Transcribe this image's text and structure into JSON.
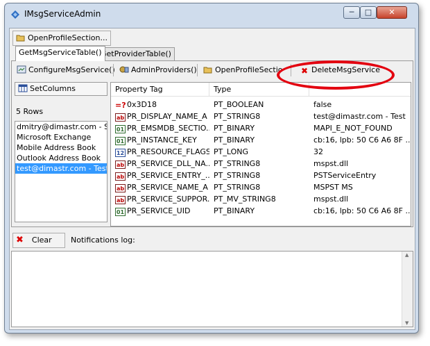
{
  "window": {
    "title": "IMsgServiceAdmin"
  },
  "toolbar": {
    "open_profile_section": "OpenProfileSection..."
  },
  "tabs": [
    {
      "label": "GetMsgServiceTable()",
      "active": true
    },
    {
      "label": "GetProviderTable()",
      "active": false
    }
  ],
  "actions": {
    "configure": "ConfigureMsgService()",
    "admin_providers": "AdminProviders()",
    "open_profile_section": "OpenProfileSectio",
    "delete": "DeleteMsgService"
  },
  "left": {
    "set_columns": "SetColumns",
    "row_count": "5 Rows",
    "services": [
      {
        "label": "dmitry@dimastr.com - SLX",
        "selected": false
      },
      {
        "label": "Microsoft Exchange",
        "selected": false
      },
      {
        "label": "Mobile Address Book",
        "selected": false
      },
      {
        "label": "Outlook Address Book",
        "selected": false
      },
      {
        "label": "test@dimastr.com - Test",
        "selected": true
      }
    ]
  },
  "grid": {
    "columns": [
      "Property Tag",
      "Type",
      ""
    ],
    "rows": [
      {
        "icon": "bool-icon",
        "glyph": "=?",
        "tag": "0x3D18",
        "type": "PT_BOOLEAN",
        "value": "false"
      },
      {
        "icon": "string-icon",
        "glyph": "ab",
        "tag": "PR_DISPLAY_NAME_A",
        "type": "PT_STRING8",
        "value": "test@dimastr.com - Test"
      },
      {
        "icon": "binary-icon",
        "glyph": "01",
        "tag": "PR_EMSMDB_SECTIO...",
        "type": "PT_BINARY",
        "value": "MAPI_E_NOT_FOUND"
      },
      {
        "icon": "binary-icon",
        "glyph": "01",
        "tag": "PR_INSTANCE_KEY",
        "type": "PT_BINARY",
        "value": "cb:16, lpb: 50 C6 A6 8F ..."
      },
      {
        "icon": "long-icon",
        "glyph": "12",
        "tag": "PR_RESOURCE_FLAGS",
        "type": "PT_LONG",
        "value": "32"
      },
      {
        "icon": "string-icon",
        "glyph": "ab",
        "tag": "PR_SERVICE_DLL_NA...",
        "type": "PT_STRING8",
        "value": "mspst.dll"
      },
      {
        "icon": "string-icon",
        "glyph": "ab",
        "tag": "PR_SERVICE_ENTRY_...",
        "type": "PT_STRING8",
        "value": "PSTServiceEntry"
      },
      {
        "icon": "string-icon",
        "glyph": "ab",
        "tag": "PR_SERVICE_NAME_A",
        "type": "PT_STRING8",
        "value": "MSPST MS"
      },
      {
        "icon": "string-icon",
        "glyph": "ab",
        "tag": "PR_SERVICE_SUPPOR...",
        "type": "PT_MV_STRING8",
        "value": "mspst.dll"
      },
      {
        "icon": "binary-icon",
        "glyph": "01",
        "tag": "PR_SERVICE_UID",
        "type": "PT_BINARY",
        "value": "cb:16, lpb: 50 C6 A6 8F ..."
      }
    ]
  },
  "bottom": {
    "clear": "Clear",
    "notifications": "Notifications log:"
  },
  "colors": {
    "selection": "#3399ff",
    "annotation": "#e3000f",
    "close": "#c7432b"
  }
}
